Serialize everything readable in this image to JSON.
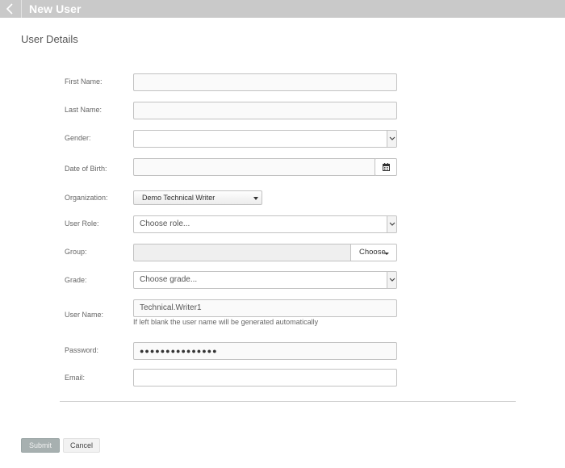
{
  "header": {
    "title": "New User",
    "back_icon": "chevron-left-icon"
  },
  "section": {
    "title": "User Details"
  },
  "form": {
    "first_name": {
      "label": "First Name:",
      "value": ""
    },
    "last_name": {
      "label": "Last Name:",
      "value": ""
    },
    "gender": {
      "label": "Gender:",
      "selected": ""
    },
    "date_of_birth": {
      "label": "Date of Birth:",
      "value": "",
      "icon": "calendar-icon"
    },
    "organization": {
      "label": "Organization:",
      "selected": "Demo Technical Writer"
    },
    "user_role": {
      "label": "User Role:",
      "selected": "Choose role..."
    },
    "group": {
      "label": "Group:",
      "value": "",
      "button_label": "Choose"
    },
    "grade": {
      "label": "Grade:",
      "selected": "Choose grade..."
    },
    "user_name": {
      "label": "User Name:",
      "value": "Technical.Writer1",
      "helper": "If left blank the user name will be generated automatically"
    },
    "password": {
      "label": "Password:",
      "masked_value": "●●●●●●●●●●●●●●●"
    },
    "email": {
      "label": "Email:",
      "value": ""
    }
  },
  "actions": {
    "submit_label": "Submit",
    "cancel_label": "Cancel"
  },
  "colors": {
    "header_bg": "#c9c9c9",
    "submit_bg": "#a7b0b0",
    "field_border": "#c2c2c2"
  }
}
